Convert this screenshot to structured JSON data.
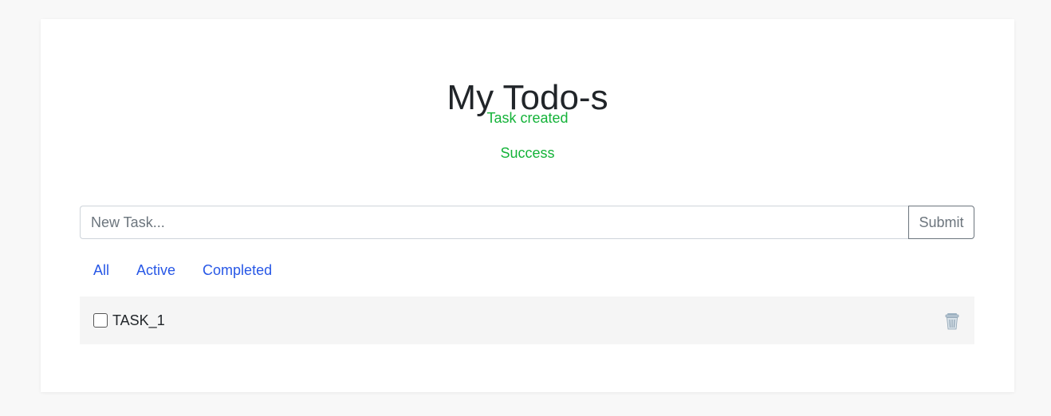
{
  "page": {
    "title": "My Todo-s",
    "messages": {
      "created": "Task created",
      "status": "Success"
    }
  },
  "form": {
    "input_placeholder": "New Task...",
    "input_value": "",
    "submit_label": "Submit"
  },
  "filters": [
    {
      "label": "All"
    },
    {
      "label": "Active"
    },
    {
      "label": "Completed"
    }
  ],
  "tasks": [
    {
      "label": "TASK_1",
      "completed": false,
      "delete_icon": "trash-icon"
    }
  ],
  "colors": {
    "accent_link": "#2757e6",
    "success": "#14b339",
    "background": "#f8f8f8"
  }
}
